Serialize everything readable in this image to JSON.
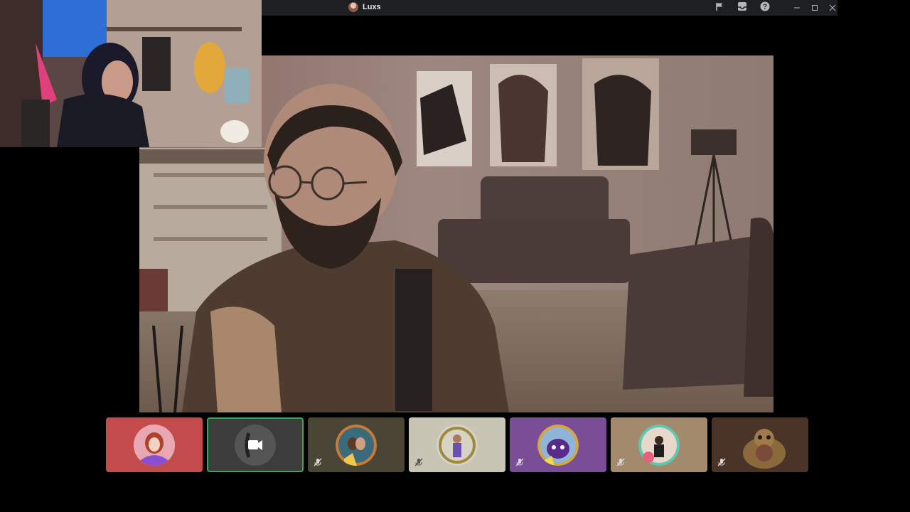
{
  "window": {
    "title": "Luxs",
    "icons": [
      "flag-icon",
      "inbox-icon",
      "help-icon"
    ],
    "controls": [
      "minimize-icon",
      "maximize-icon",
      "close-icon"
    ]
  },
  "colors": {
    "titlebar_bg": "#1e1f22",
    "selected_border": "#3ba55c"
  },
  "participants": [
    {
      "tile_bg": "#c44b4b",
      "muted": false,
      "selected": false,
      "avatar": "avatar-red-hair"
    },
    {
      "tile_bg": "#3c3c3c",
      "muted": false,
      "selected": true,
      "avatar": "camera-icon"
    },
    {
      "tile_bg": "#4a4535",
      "muted": true,
      "selected": false,
      "avatar": "avatar-couple"
    },
    {
      "tile_bg": "#c8c5b4",
      "muted": true,
      "selected": false,
      "avatar": "avatar-laurel"
    },
    {
      "tile_bg": "#7a4e96",
      "muted": true,
      "selected": false,
      "avatar": "avatar-purple-creature"
    },
    {
      "tile_bg": "#a48a6c",
      "muted": true,
      "selected": false,
      "avatar": "avatar-portrait"
    },
    {
      "tile_bg": "#4a3428",
      "muted": true,
      "selected": false,
      "avatar": "avatar-otter"
    }
  ]
}
